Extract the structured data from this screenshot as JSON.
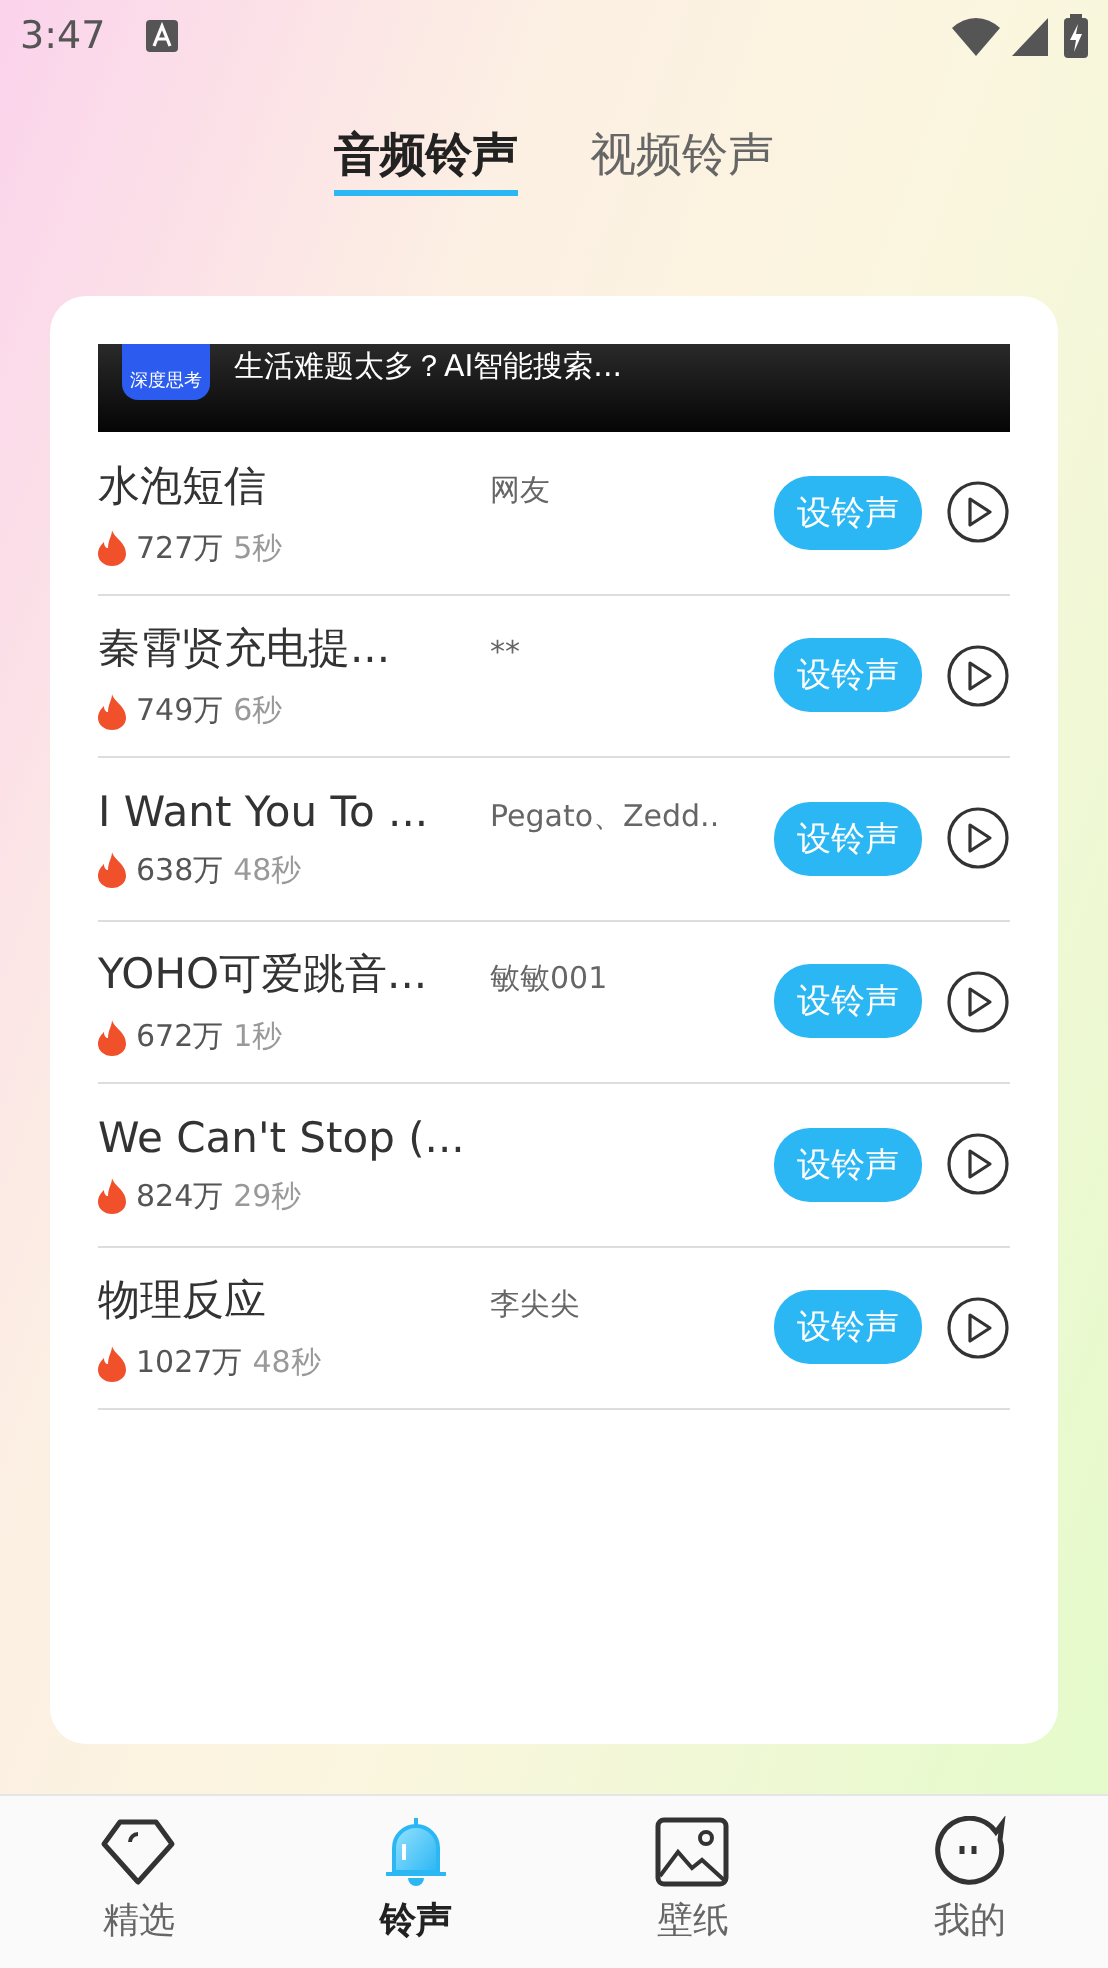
{
  "status_bar": {
    "time": "3:47"
  },
  "tabs": [
    {
      "label": "音频铃声",
      "selected": true
    },
    {
      "label": "视频铃声",
      "selected": false
    }
  ],
  "ad": {
    "logo_text": "深度思考",
    "text": "生活难题太多？AI智能搜索..."
  },
  "ringtones": [
    {
      "title": "水泡短信",
      "artist": "网友",
      "plays": "727万",
      "duration": "5秒",
      "button": "设铃声"
    },
    {
      "title": "秦霄贤充电提...",
      "artist": "**",
      "plays": "749万",
      "duration": "6秒",
      "button": "设铃声"
    },
    {
      "title": "I Want You To ...",
      "artist": "Pegato、Zedd..",
      "plays": "638万",
      "duration": "48秒",
      "button": "设铃声"
    },
    {
      "title": "YOHO可爱跳音...",
      "artist": "敏敏001",
      "plays": "672万",
      "duration": "1秒",
      "button": "设铃声"
    },
    {
      "title": "We Can't Stop (...",
      "plays": "824万",
      "duration": "29秒",
      "button": "设铃声"
    },
    {
      "title": "物理反应",
      "artist": "李尖尖",
      "plays": "1027万",
      "duration": "48秒",
      "button": "设铃声"
    }
  ],
  "nav": [
    {
      "kind": "diamond",
      "label": "精选",
      "selected": false
    },
    {
      "kind": "bell",
      "label": "铃声",
      "selected": true
    },
    {
      "kind": "picture",
      "label": "壁纸",
      "selected": false
    },
    {
      "kind": "face",
      "label": "我的",
      "selected": false
    }
  ]
}
